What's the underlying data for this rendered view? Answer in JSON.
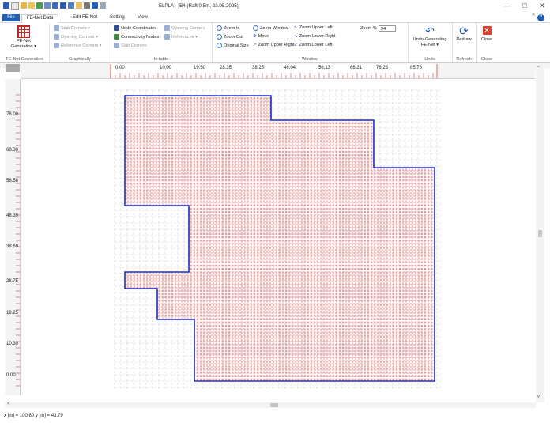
{
  "window": {
    "title": "ELPLA - [B4 (Raft 0.5m, 23.05.2025)]",
    "controls": [
      "—",
      "□",
      "✕"
    ]
  },
  "tabs": [
    "File",
    "FE-Net Data",
    "Edit FE-Net",
    "Setting",
    "View"
  ],
  "ribbon": {
    "fe_net_generation": {
      "button": "FE-Net Generation ▾",
      "label": "FE-Net Generation"
    },
    "graphically": {
      "items": [
        "Slab Corners ▾",
        "Opening Corners ▾",
        "Reference Corners ▾"
      ],
      "label": "Graphically"
    },
    "in_table": {
      "items": [
        "Node Coordinates",
        "Opening Corners",
        "Connectivity Nodes",
        "References ▾",
        "Slab Corners"
      ],
      "label": "In table"
    },
    "window": {
      "items": [
        "Zoom In",
        "Zoom Window",
        "Zoom Upper Left",
        "Zoom Out",
        "Move",
        "Zoom Lower Right",
        "Original Size",
        "Zoom Upper Right",
        "Zoom Lower Left"
      ],
      "zoom_label": "Zoom %",
      "zoom_value": "94",
      "label": "Window"
    },
    "undo": {
      "button": "Undo-Generating FE-Net ▾",
      "label": "Undo"
    },
    "refresh": {
      "button": "Redraw",
      "label": "Refresh"
    },
    "close": {
      "button": "Close",
      "label": "Close"
    }
  },
  "ruler_h": [
    "0.00",
    "10.00",
    "19.50",
    "28.35",
    "38.25",
    "46.04",
    "56.13",
    "66.21",
    "76.25",
    "85.78"
  ],
  "ruler_v": [
    "78.00",
    "68.30",
    "58.58",
    "48.39",
    "38.69",
    "28.75",
    "19.25",
    "10.30",
    "0.00"
  ],
  "status": "x [m] = 100.80   y [m] = 43.79",
  "colors": {
    "mesh_inside": "#e23a3a",
    "mesh_outside": "#bdbdbd",
    "outline": "#1a2ec8",
    "file_tab": "#1f5fb4"
  }
}
